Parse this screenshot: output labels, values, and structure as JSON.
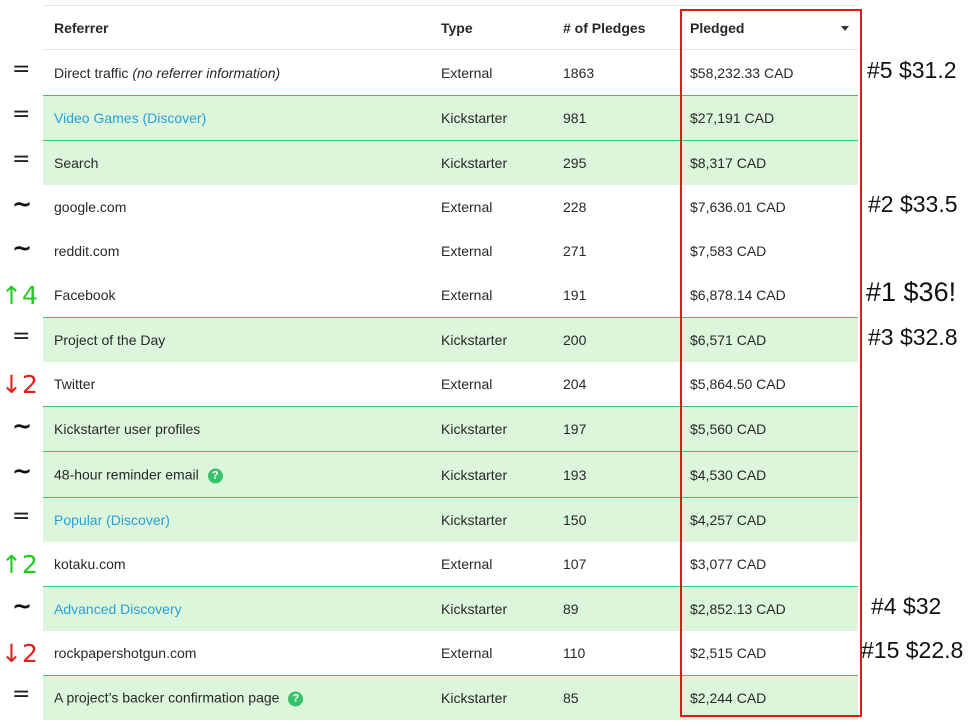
{
  "table": {
    "headers": {
      "referrer": "Referrer",
      "type": "Type",
      "pledges": "# of Pledges",
      "pledged": "Pledged"
    },
    "rows": [
      {
        "referrer": "Direct traffic",
        "referrer_note": "(no referrer information)",
        "type": "External",
        "pledges": "1863",
        "pledged": "$58,232.33 CAD",
        "kickstarter": false,
        "link": false,
        "help": false
      },
      {
        "referrer": "Video Games (Discover)",
        "type": "Kickstarter",
        "pledges": "981",
        "pledged": "$27,191 CAD",
        "kickstarter": true,
        "link": true,
        "help": false
      },
      {
        "referrer": "Search",
        "type": "Kickstarter",
        "pledges": "295",
        "pledged": "$8,317 CAD",
        "kickstarter": true,
        "link": false,
        "help": false
      },
      {
        "referrer": "google.com",
        "type": "External",
        "pledges": "228",
        "pledged": "$7,636.01 CAD",
        "kickstarter": false,
        "link": false,
        "help": false
      },
      {
        "referrer": "reddit.com",
        "type": "External",
        "pledges": "271",
        "pledged": "$7,583 CAD",
        "kickstarter": false,
        "link": false,
        "help": false
      },
      {
        "referrer": "Facebook",
        "type": "External",
        "pledges": "191",
        "pledged": "$6,878.14 CAD",
        "kickstarter": false,
        "link": false,
        "help": false
      },
      {
        "referrer": "Project of the Day",
        "type": "Kickstarter",
        "pledges": "200",
        "pledged": "$6,571 CAD",
        "kickstarter": true,
        "link": false,
        "help": false
      },
      {
        "referrer": "Twitter",
        "type": "External",
        "pledges": "204",
        "pledged": "$5,864.50 CAD",
        "kickstarter": false,
        "link": false,
        "help": false
      },
      {
        "referrer": "Kickstarter user profiles",
        "type": "Kickstarter",
        "pledges": "197",
        "pledged": "$5,560 CAD",
        "kickstarter": true,
        "link": false,
        "help": false
      },
      {
        "referrer": "48-hour reminder email",
        "type": "Kickstarter",
        "pledges": "193",
        "pledged": "$4,530 CAD",
        "kickstarter": true,
        "link": false,
        "help": true
      },
      {
        "referrer": "Popular (Discover)",
        "type": "Kickstarter",
        "pledges": "150",
        "pledged": "$4,257 CAD",
        "kickstarter": true,
        "link": true,
        "help": false
      },
      {
        "referrer": "kotaku.com",
        "type": "External",
        "pledges": "107",
        "pledged": "$3,077 CAD",
        "kickstarter": false,
        "link": false,
        "help": false
      },
      {
        "referrer": "Advanced Discovery",
        "type": "Kickstarter",
        "pledges": "89",
        "pledged": "$2,852.13 CAD",
        "kickstarter": true,
        "link": true,
        "help": false
      },
      {
        "referrer": "rockpapershotgun.com",
        "type": "External",
        "pledges": "110",
        "pledged": "$2,515 CAD",
        "kickstarter": false,
        "link": false,
        "help": false
      },
      {
        "referrer": "A project’s backer confirmation page",
        "type": "Kickstarter",
        "pledges": "85",
        "pledged": "$2,244 CAD",
        "kickstarter": true,
        "link": false,
        "help": true
      }
    ]
  },
  "rank_marks": [
    {
      "text": "=",
      "kind": "eq"
    },
    {
      "text": "=",
      "kind": "eq"
    },
    {
      "text": "=",
      "kind": "eq"
    },
    {
      "text": "~",
      "kind": "tilde"
    },
    {
      "text": "~",
      "kind": "tilde"
    },
    {
      "text": "↑4",
      "kind": "up"
    },
    {
      "text": "=",
      "kind": "eq"
    },
    {
      "text": "↓2",
      "kind": "down"
    },
    {
      "text": "~",
      "kind": "tilde"
    },
    {
      "text": "~",
      "kind": "tilde"
    },
    {
      "text": "=",
      "kind": "eq"
    },
    {
      "text": "↑2",
      "kind": "up"
    },
    {
      "text": "~",
      "kind": "tilde"
    },
    {
      "text": "↓2",
      "kind": "down"
    },
    {
      "text": "=",
      "kind": "eq"
    }
  ],
  "annotations": [
    {
      "row": 0,
      "text": "#5 $31.2"
    },
    {
      "row": 3,
      "text": "#2 $33.5"
    },
    {
      "row": 5,
      "text": "#1 $36!"
    },
    {
      "row": 6,
      "text": "#3 $32.8"
    },
    {
      "row": 12,
      "text": "#4 $32"
    },
    {
      "row": 13,
      "text": "#15 $22.8"
    }
  ],
  "colors": {
    "kickstarter_row_bg": "#dcf6dc",
    "row_separator": "#38c46c",
    "link": "#2a9fd8",
    "highlight_border": "#e01818",
    "rank_up": "#22cc22",
    "rank_down": "#e02020",
    "help_icon": "#3bc16c"
  },
  "icons": {
    "sort": "caret-down-icon",
    "help": "question-circle-icon"
  }
}
